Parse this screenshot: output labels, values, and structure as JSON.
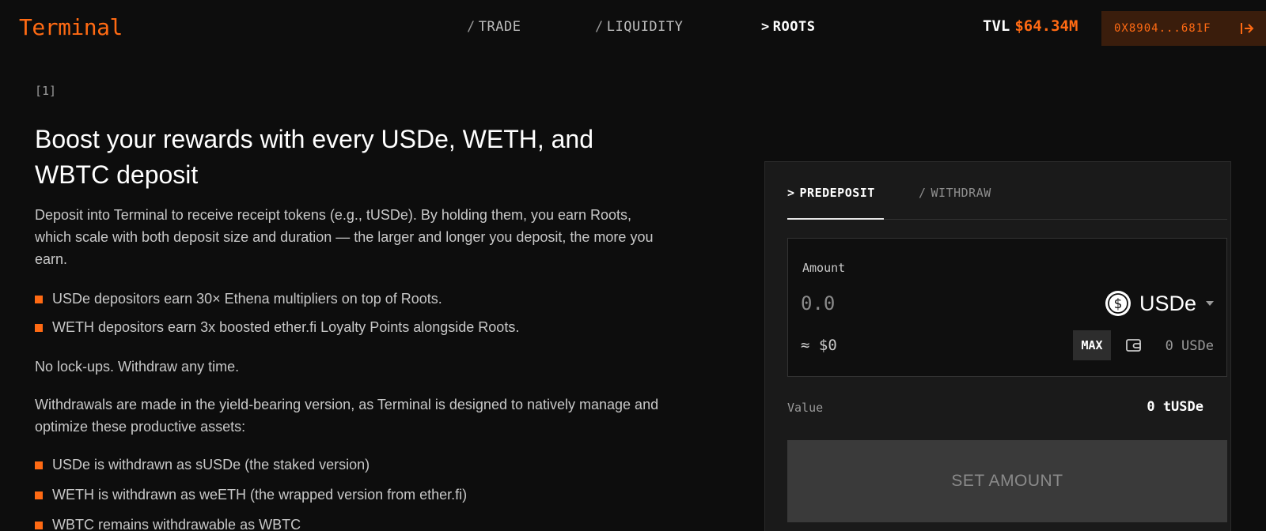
{
  "header": {
    "logo": "Terminal",
    "nav": [
      {
        "prefix": "/",
        "label": "TRADE"
      },
      {
        "prefix": "/",
        "label": "LIQUIDITY"
      },
      {
        "prefix": ">",
        "label": "ROOTS"
      }
    ],
    "tvl_label": "TVL",
    "tvl_value": "$64.34M",
    "wallet_address": "0X8904...681F",
    "wallet_icon": "exit-icon"
  },
  "main": {
    "step": "[1]",
    "headline": "Boost your rewards with every USDe, WETH, and WBTC deposit",
    "intro": "Deposit into Terminal to receive receipt tokens (e.g., tUSDe). By holding them, you earn Roots, which scale with both deposit size and duration — the larger and longer you deposit, the more you earn.",
    "bullets_earn": [
      "USDe depositors earn 30× Ethena multipliers on top of Roots.",
      "WETH depositors earn 3x boosted ether.fi Loyalty Points alongside Roots."
    ],
    "no_lockups": "No lock-ups. Withdraw any time.",
    "withdraw_note": "Withdrawals are made in the yield-bearing version, as Terminal is designed to natively manage and optimize these productive assets:",
    "bullets_withdraw": [
      "USDe is withdrawn as sUSDe (the staked version)",
      "WETH is withdrawn as weETH (the wrapped version from ether.fi)",
      "WBTC remains withdrawable as WBTC"
    ]
  },
  "panel": {
    "tabs": [
      {
        "prefix": ">",
        "label": "PREDEPOSIT"
      },
      {
        "prefix": "/",
        "label": "WITHDRAW"
      }
    ],
    "amount_label": "Amount",
    "amount_placeholder": "0.0",
    "token": "USDe",
    "token_icon": "dollar-circle-icon",
    "usd_approx": "≈ $0",
    "max_label": "MAX",
    "balance": "0 USDe",
    "value_label": "Value",
    "value_amount": "0 tUSDe",
    "submit_label": "SET AMOUNT"
  },
  "colors": {
    "accent": "#ff6a13",
    "background": "#0d0d0d",
    "panel": "#1a1a1a"
  }
}
